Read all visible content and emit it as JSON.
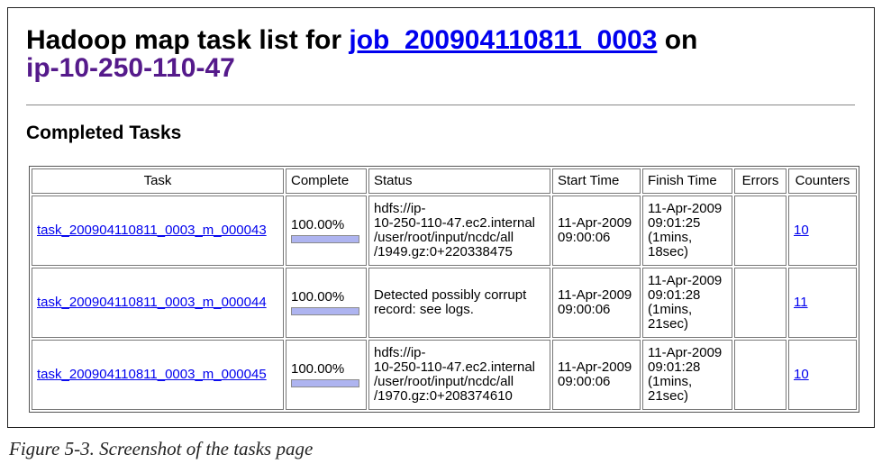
{
  "page": {
    "title_prefix": "Hadoop map task list for ",
    "job_link": "job_200904110811_0003",
    "title_mid": " on",
    "host_link": "ip-10-250-110-47",
    "section_title": "Completed Tasks"
  },
  "table": {
    "headers": [
      "Task",
      "Complete",
      "Status",
      "Start Time",
      "Finish Time",
      "Errors",
      "Counters"
    ],
    "rows": [
      {
        "task": "task_200904110811_0003_m_000043",
        "complete": "100.00%",
        "progress": 1.0,
        "status_lines": [
          "hdfs://ip-",
          "10-250-110-47.ec2.internal",
          "/user/root/input/ncdc/all",
          "/1949.gz:0+220338475"
        ],
        "start_lines": [
          "11-Apr-2009",
          "09:00:06"
        ],
        "finish_lines": [
          "11-Apr-2009",
          "09:01:25",
          "(1mins,",
          "18sec)"
        ],
        "errors": "",
        "counters": "10"
      },
      {
        "task": "task_200904110811_0003_m_000044",
        "complete": "100.00%",
        "progress": 1.0,
        "status_lines": [
          "Detected possibly corrupt",
          "record: see logs."
        ],
        "start_lines": [
          "11-Apr-2009",
          "09:00:06"
        ],
        "finish_lines": [
          "11-Apr-2009",
          "09:01:28",
          "(1mins,",
          "21sec)"
        ],
        "errors": "",
        "counters": "11"
      },
      {
        "task": "task_200904110811_0003_m_000045",
        "complete": "100.00%",
        "progress": 1.0,
        "status_lines": [
          "hdfs://ip-",
          "10-250-110-47.ec2.internal",
          "/user/root/input/ncdc/all",
          "/1970.gz:0+208374610"
        ],
        "start_lines": [
          "11-Apr-2009",
          "09:00:06"
        ],
        "finish_lines": [
          "11-Apr-2009",
          "09:01:28",
          "(1mins,",
          "21sec)"
        ],
        "errors": "",
        "counters": "10"
      }
    ]
  },
  "caption": "Figure 5-3. Screenshot of the tasks page",
  "colors": {
    "link": "#0000ee",
    "visited_link": "#551a8b",
    "progress_fill": "#aeb4f0"
  }
}
